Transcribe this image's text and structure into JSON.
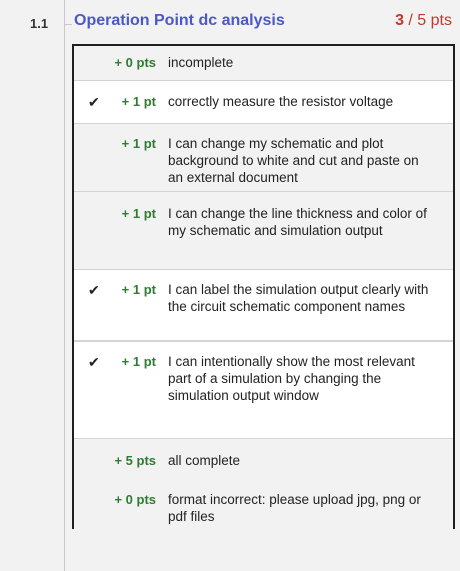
{
  "question": {
    "number": "1.1",
    "title": "Operation Point dc analysis",
    "score_earned": "3",
    "score_rest": " / 5 pts"
  },
  "rubric_items": [
    {
      "points": "+ 0 pts",
      "description": "incomplete",
      "checked": false,
      "check_glyph": ""
    },
    {
      "points": "+ 1 pt",
      "description": "correctly measure the resistor voltage",
      "checked": true,
      "check_glyph": "✔"
    },
    {
      "points": "+ 1 pt",
      "description": "I can change my schematic and plot background to white and cut and paste on an external document",
      "checked": false,
      "check_glyph": ""
    },
    {
      "points": "+ 1 pt",
      "description": "I can change the line thickness and color of my schematic and simulation output",
      "checked": false,
      "check_glyph": ""
    },
    {
      "points": "+ 1 pt",
      "description": "I can label the simulation output clearly with the circuit schematic component names",
      "checked": true,
      "check_glyph": "✔"
    },
    {
      "points": "+ 1 pt",
      "description": "I can intentionally show the most relevant part of a simulation by changing the simulation output window",
      "checked": true,
      "check_glyph": "✔"
    },
    {
      "points": "+ 5 pts",
      "description": "all complete",
      "checked": false,
      "check_glyph": ""
    },
    {
      "points": "+ 0 pts",
      "description": "format incorrect: please upload jpg, png or pdf files",
      "checked": false,
      "check_glyph": ""
    }
  ],
  "colors": {
    "title": "#4b58c9",
    "score": "#c0392b",
    "points": "#2e7d32"
  }
}
